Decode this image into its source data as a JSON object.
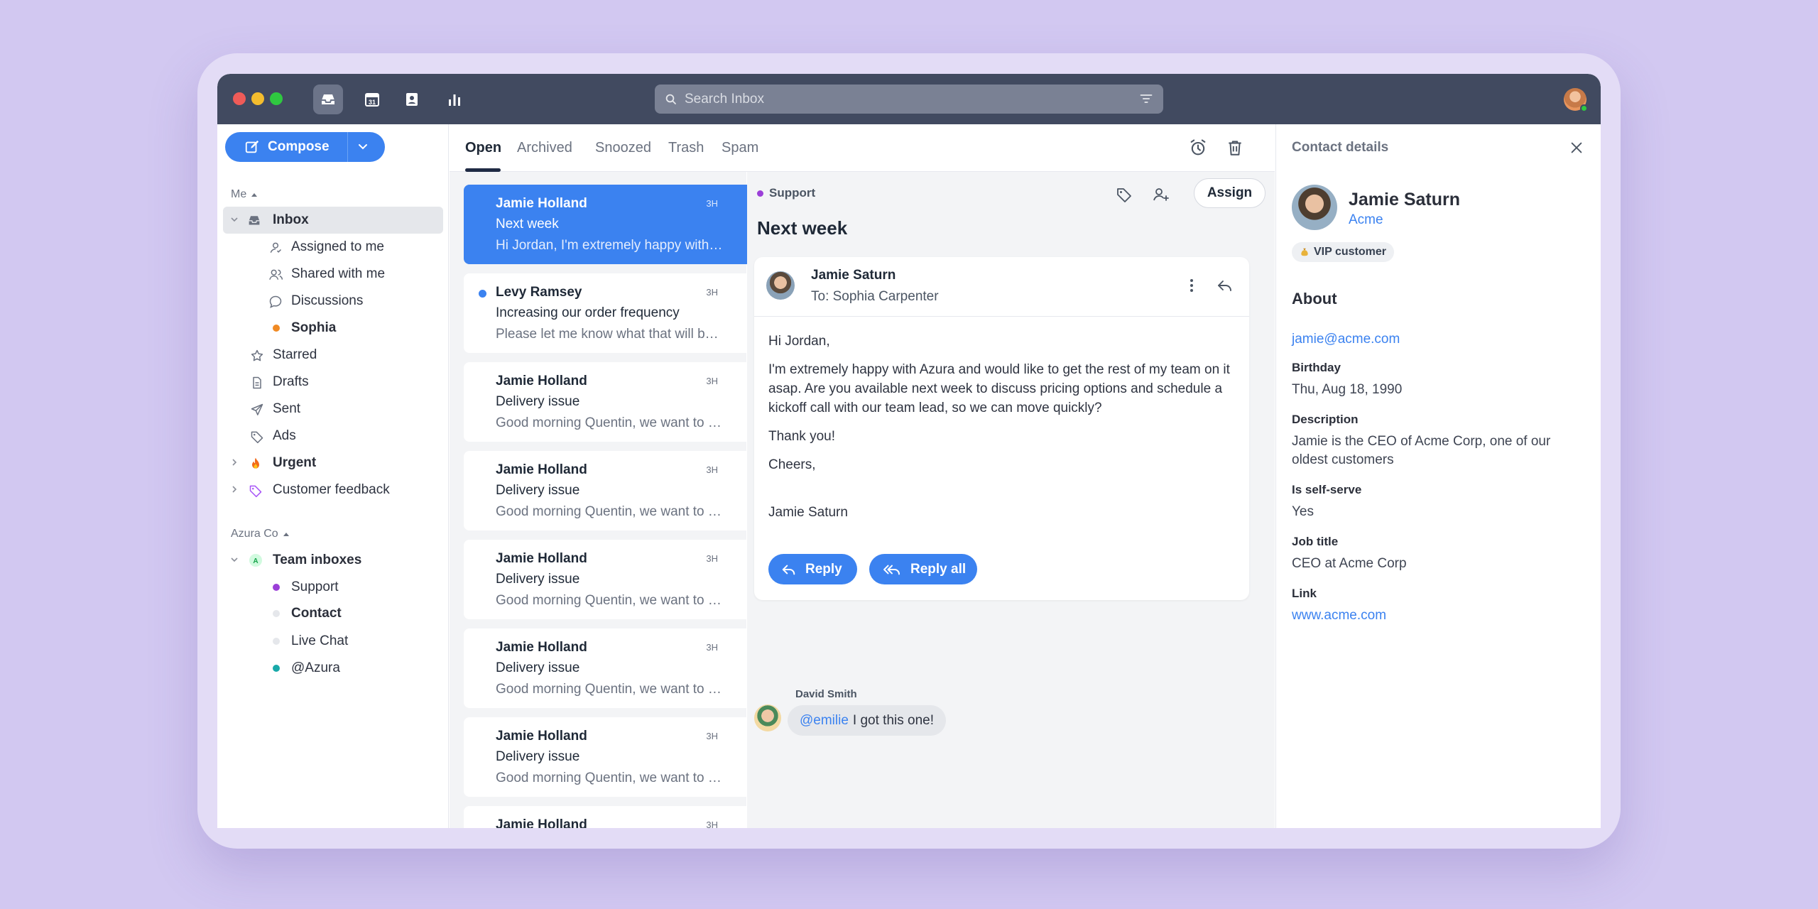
{
  "titlebar": {
    "search_placeholder": "Search Inbox"
  },
  "sidebar": {
    "compose_label": "Compose",
    "me_label": "Me",
    "items": [
      {
        "label": "Inbox"
      },
      {
        "label": "Assigned to me"
      },
      {
        "label": "Shared with me"
      },
      {
        "label": "Discussions"
      },
      {
        "label": "Sophia"
      },
      {
        "label": "Starred"
      },
      {
        "label": "Drafts"
      },
      {
        "label": "Sent"
      },
      {
        "label": "Ads"
      },
      {
        "label": "Urgent"
      },
      {
        "label": "Customer feedback"
      }
    ],
    "team_label": "Azura Co",
    "team_items": [
      {
        "label": "Team inboxes"
      },
      {
        "label": "Support"
      },
      {
        "label": "Contact"
      },
      {
        "label": "Live Chat"
      },
      {
        "label": "@Azura"
      }
    ]
  },
  "tabs": [
    "Open",
    "Archived",
    "Snoozed",
    "Trash",
    "Spam"
  ],
  "messages": [
    {
      "from": "Jamie Holland",
      "time": "3H",
      "subject": "Next week",
      "preview": "Hi Jordan, I'm extremely happy with Azura and would like"
    },
    {
      "from": "Levy Ramsey",
      "time": "3H",
      "subject": "Increasing our order frequency",
      "preview": "Please let me know what that will be needed"
    },
    {
      "from": "Jamie Holland",
      "time": "3H",
      "subject": "Delivery issue",
      "preview": "Good morning Quentin, we want to let you know"
    },
    {
      "from": "Jamie Holland",
      "time": "3H",
      "subject": "Delivery issue",
      "preview": "Good morning Quentin, we want to let you know"
    },
    {
      "from": "Jamie Holland",
      "time": "3H",
      "subject": "Delivery issue",
      "preview": "Good morning Quentin, we want to let you know"
    },
    {
      "from": "Jamie Holland",
      "time": "3H",
      "subject": "Delivery issue",
      "preview": "Good morning Quentin, we want to let you know"
    },
    {
      "from": "Jamie Holland",
      "time": "3H",
      "subject": "Delivery issue",
      "preview": "Good morning Quentin, we want to let you know"
    },
    {
      "from": "Jamie Holland",
      "time": "3H",
      "subject": "",
      "preview": ""
    }
  ],
  "conversation": {
    "tag": "Support",
    "title": "Next week",
    "assign_label": "Assign",
    "from": "Jamie Saturn",
    "to": "To: Sophia Carpenter",
    "body": [
      "Hi Jordan,",
      "I'm extremely happy with Azura and would like to get the rest of my team on it asap. Are you available next week to discuss pricing options and schedule a kickoff call with our team lead, so we can move quickly?",
      "Thank you!",
      "Cheers,",
      "Jamie Saturn"
    ],
    "reply_label": "Reply",
    "reply_all_label": "Reply all",
    "note_author": "David Smith",
    "note_mention": "@emilie",
    "note_text": "I got this one!"
  },
  "contact": {
    "title": "Contact details",
    "name": "Jamie Saturn",
    "company": "Acme",
    "badge": "VIP customer",
    "about_label": "About",
    "email": "jamie@acme.com",
    "birthday_label": "Birthday",
    "birthday": "Thu, Aug 18, 1990",
    "description_label": "Description",
    "description": "Jamie is the CEO of Acme Corp, one of our oldest customers",
    "self_serve_label": "Is self-serve",
    "self_serve": "Yes",
    "job_title_label": "Job title",
    "job_title": "CEO at Acme Corp",
    "link_label": "Link",
    "link": "www.acme.com"
  },
  "colors": {
    "accent": "#3b82f0",
    "titlebar": "#414a60",
    "background": "#d2c8f1",
    "sophia_dot": "#f08a24",
    "support_dot": "#9b3fd8",
    "azura_dot": "#18a9a9"
  }
}
